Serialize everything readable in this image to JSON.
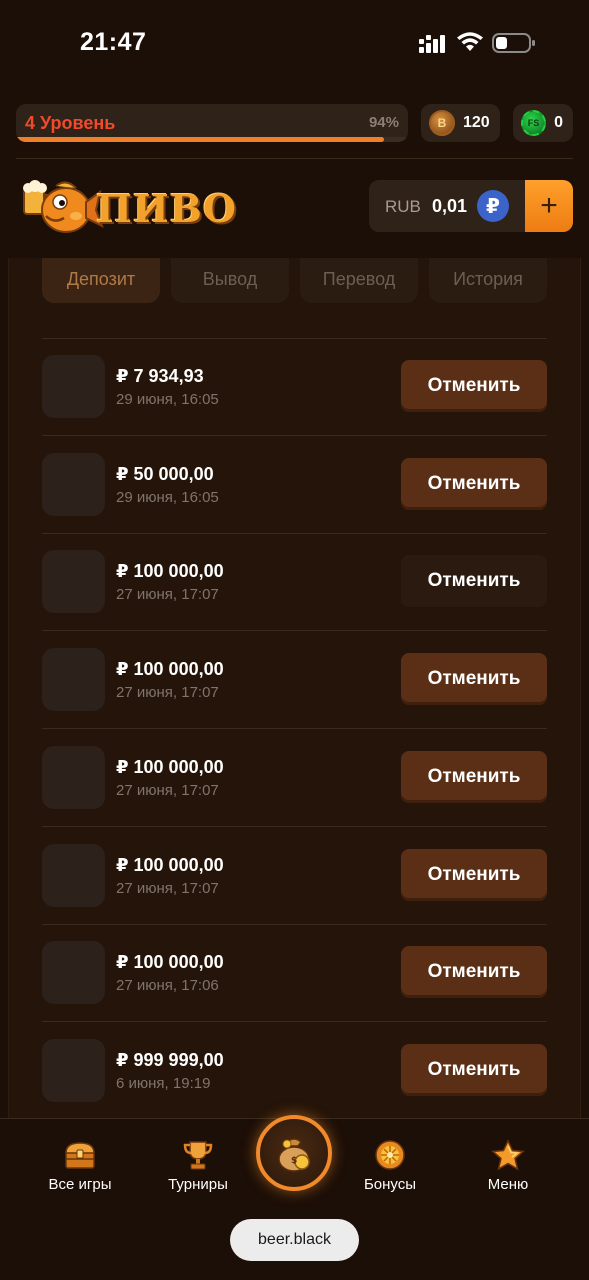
{
  "status_bar": {
    "time": "21:47",
    "icons": [
      "signal-icon",
      "wifi-icon",
      "battery-icon"
    ]
  },
  "header": {
    "level_label": "4 Уровень",
    "level_percent": "94%",
    "level_progress": 0.94,
    "b_coin": {
      "icon": "b-coin-icon",
      "letter": "B",
      "value": "120"
    },
    "fs_coin": {
      "icon": "fs-coin-icon",
      "letter": "FS",
      "value": "0"
    }
  },
  "brand": {
    "logo_text": "ПИВО",
    "icon": "fish-beer-mascot-icon"
  },
  "balance": {
    "currency": "RUB",
    "amount": "0,01",
    "currency_symbol": "₽",
    "add_label": "+"
  },
  "tabs": [
    {
      "label": "Депозит",
      "active": true
    },
    {
      "label": "Вывод",
      "active": false
    },
    {
      "label": "Перевод",
      "active": false
    },
    {
      "label": "История",
      "active": false
    }
  ],
  "transactions": [
    {
      "amount": "₽ 7 934,93",
      "date": "29 июня, 16:05",
      "action": "Отменить"
    },
    {
      "amount": "₽ 50 000,00",
      "date": "29 июня, 16:05",
      "action": "Отменить"
    },
    {
      "amount": "₽ 100 000,00",
      "date": "27 июня, 17:07",
      "action": "Отменить"
    },
    {
      "amount": "₽ 100 000,00",
      "date": "27 июня, 17:07",
      "action": "Отменить"
    },
    {
      "amount": "₽ 100 000,00",
      "date": "27 июня, 17:07",
      "action": "Отменить"
    },
    {
      "amount": "₽ 100 000,00",
      "date": "27 июня, 17:07",
      "action": "Отменить"
    },
    {
      "amount": "₽ 100 000,00",
      "date": "27 июня, 17:06",
      "action": "Отменить"
    },
    {
      "amount": "₽ 999 999,00",
      "date": "6 июня, 19:19",
      "action": "Отменить"
    }
  ],
  "bottom_nav": [
    {
      "label": "Все игры",
      "icon": "treasure-chest-icon"
    },
    {
      "label": "Турниры",
      "icon": "trophy-icon"
    },
    {
      "label": "",
      "icon": "money-bag-icon"
    },
    {
      "label": "Бонусы",
      "icon": "wheel-icon"
    },
    {
      "label": "Меню",
      "icon": "star-icon"
    }
  ],
  "browser": {
    "url": "beer.black"
  },
  "colors": {
    "background": "#1c0f07",
    "accent_orange": "#f07f2a",
    "level_red": "#f04a2c",
    "cancel_button": "#5a2f16",
    "rub_blue": "#3b63c9"
  }
}
